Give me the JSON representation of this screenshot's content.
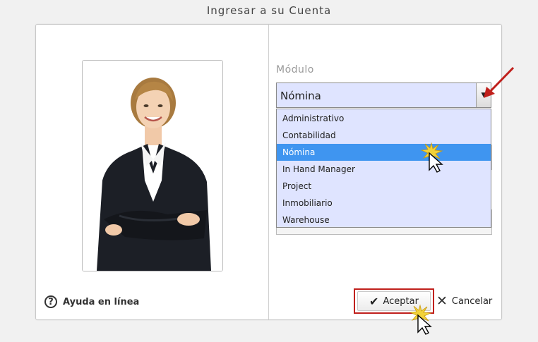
{
  "window": {
    "title": "Ingresar a su Cuenta"
  },
  "left_panel": {
    "help_link": "Ayuda en línea",
    "help_icon": "help-circle-icon"
  },
  "form": {
    "module_label": "Módulo",
    "module_select": {
      "value": "Nómina",
      "options": [
        "Administrativo",
        "Contabilidad",
        "Nómina",
        "In Hand Manager",
        "Project",
        "Inmobiliario",
        "Warehouse"
      ],
      "selected_index": 2
    }
  },
  "buttons": {
    "accept_label": "Aceptar",
    "accept_icon": "check-icon",
    "cancel_label": "Cancelar",
    "cancel_icon": "close-icon"
  },
  "colors": {
    "select_bg": "#dfe4ff",
    "selected_option": "#3f95f0",
    "annotation_red": "#c0201c"
  }
}
